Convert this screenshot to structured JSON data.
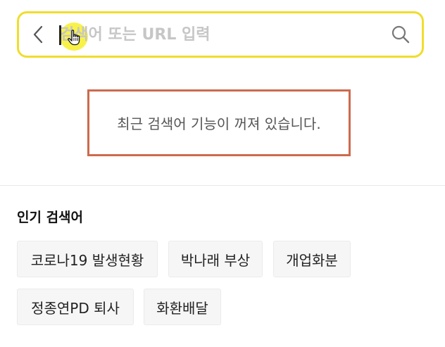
{
  "search": {
    "placeholder": "검색어 또는 URL 입력",
    "value": ""
  },
  "icons": {
    "back": "chevron-left-icon",
    "search": "magnifier-icon",
    "pointer": "hand-pointer-icon"
  },
  "colors": {
    "search_border": "#f0dd2c",
    "notice_border": "#cd6a4d",
    "cursor_highlight": "#f7f028"
  },
  "notice": {
    "text": "최근 검색어 기능이 꺼져 있습니다."
  },
  "popular": {
    "title": "인기 검색어",
    "keywords": [
      "코로나19 발생현황",
      "박나래 부상",
      "개업화분",
      "정종연PD 퇴사",
      "화환배달"
    ]
  }
}
